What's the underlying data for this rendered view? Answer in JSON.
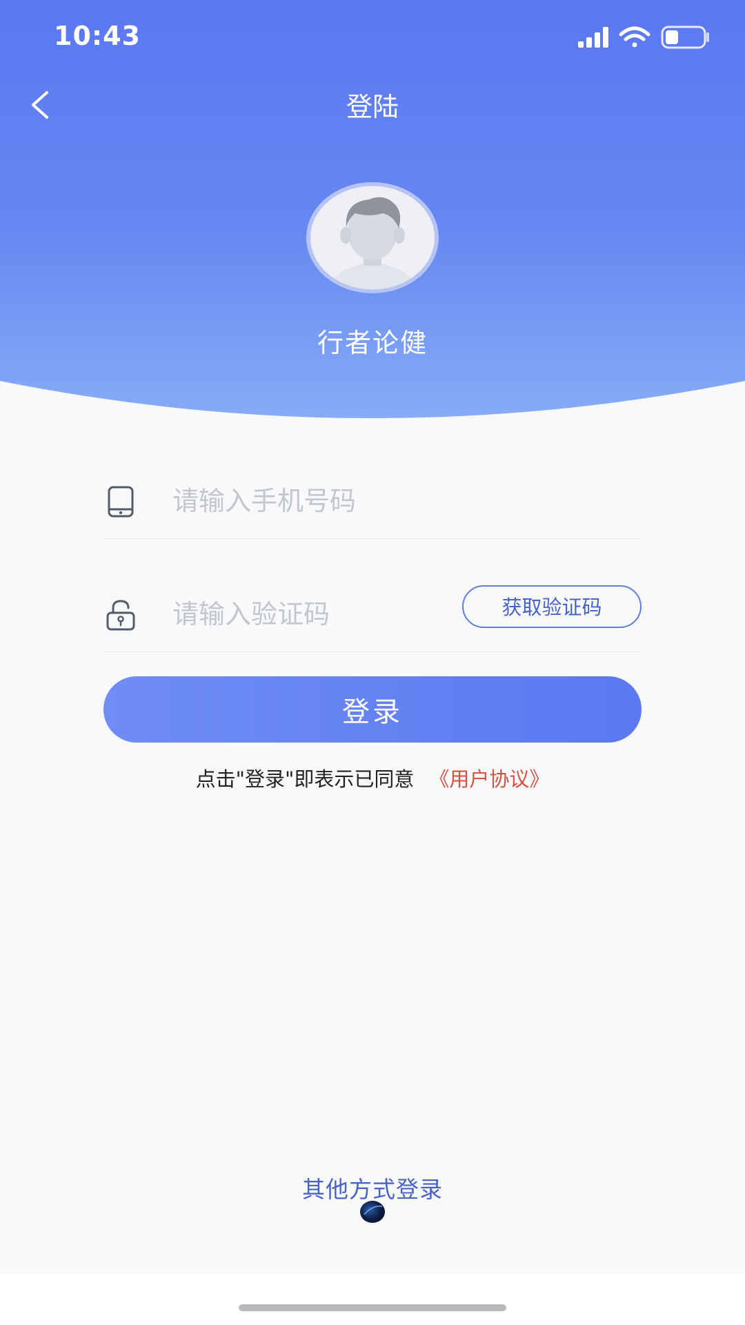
{
  "status_bar": {
    "time": "10:43",
    "signal_icon": "signal-bars-icon",
    "wifi_icon": "wifi-icon",
    "battery_icon": "battery-icon",
    "battery_level": 0.3
  },
  "nav": {
    "back_icon": "chevron-left-icon",
    "title": "登陆"
  },
  "profile": {
    "avatar_icon": "default-avatar",
    "app_name": "行者论健"
  },
  "form": {
    "phone": {
      "icon": "phone-icon",
      "value": "",
      "placeholder": "请输入手机号码"
    },
    "code": {
      "icon": "lock-icon",
      "value": "",
      "placeholder": "请输入验证码",
      "get_code_label": "获取验证码"
    },
    "login_label": "登录",
    "agreement_text": "点击\"登录\"即表示已同意",
    "agreement_link": "《用户协议》"
  },
  "footer": {
    "other_login_label": "其他方式登录"
  },
  "colors": {
    "header_gradient_top": "#5b77f1",
    "header_gradient_bottom": "#84abf6",
    "accent": "#5f7ddc",
    "link_red": "#d9503f",
    "background": "#f8f9fb"
  }
}
